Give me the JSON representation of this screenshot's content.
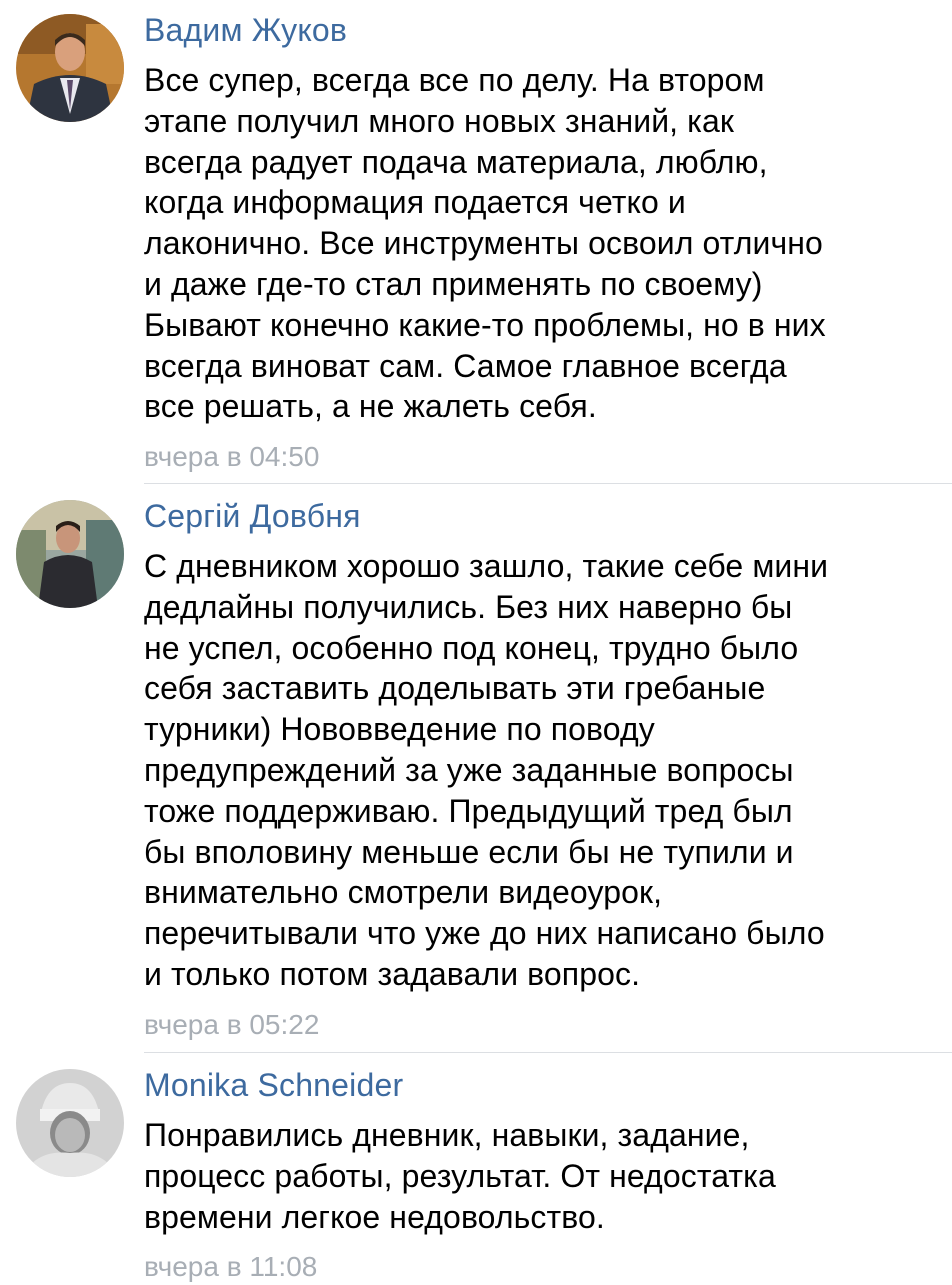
{
  "comments": [
    {
      "author": "Вадим Жуков",
      "text": "Все супер, всегда все по делу. На втором\nэтапе получил много новых знаний, как\nвсегда радует подача материала, люблю,\nкогда информация подается четко и\nлаконично. Все инструменты освоил отлично\nи даже где-то стал применять по своему)\nБывают конечно какие-то проблемы, но в них\nвсегда виноват сам. Самое главное всегда\nвсе решать, а не жалеть себя.",
      "time": "вчера в 04:50"
    },
    {
      "author": "Сергій Довбня",
      "text": "С дневником хорошо зашло, такие себе мини\nдедлайны получились. Без них наверно бы\nне успел, особенно под конец, трудно было\nсебя заставить доделывать эти гребаные\nтурники) Нововведение по поводу\nпредупреждений за уже заданные вопросы\nтоже поддерживаю. Предыдущий тред был\nбы вполовину меньше если бы не тупили и\nвнимательно смотрели видеоурок,\nперечитывали что уже до них написано было\nи только потом задавали вопрос.",
      "time": "вчера в 05:22"
    },
    {
      "author": "Monika Schneider",
      "text": "Понравились дневник, навыки, задание,\nпроцесс работы, результат. От недостатка\nвремени легкое недовольство.",
      "time": "вчера в 11:08"
    }
  ]
}
